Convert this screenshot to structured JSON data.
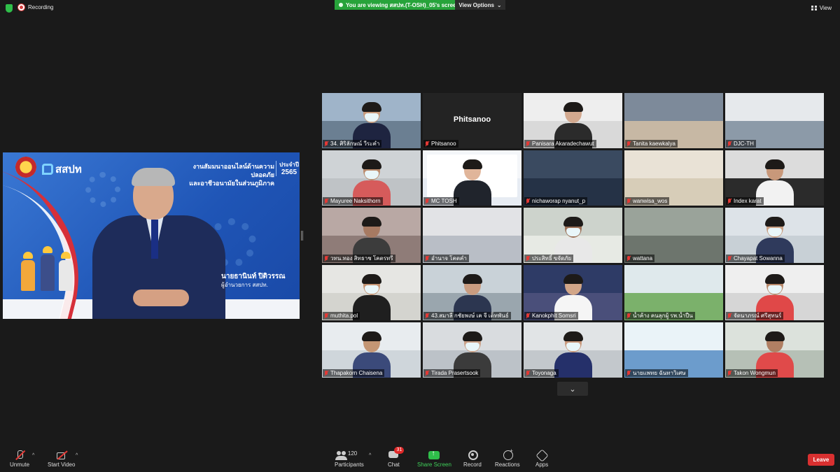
{
  "topbar": {
    "recording_label": "Recording",
    "viewing_text": "You are viewing สสปท.(T-OSH)_05's screen",
    "view_options_label": "View Options",
    "view_label": "View"
  },
  "shared_screen": {
    "brand": "สสปท",
    "headline_line1": "งานสัมมนาออนไลน์ด้านความปลอดภัย",
    "headline_line2": "และอาชีวอนามัยในส่วนภูมิภาค",
    "year_label": "ประจำปี",
    "year": "2565",
    "speaker_name": "นายธานินท์ ปิติวรรณ",
    "speaker_title": "ผู้อำนวยการ สสปท."
  },
  "gallery": {
    "tiles": [
      {
        "name": "34. ศิริลักษณ์ วีระคำ",
        "style": "p1"
      },
      {
        "name": "Phitsanoo",
        "style": "nameonly",
        "center_name": "Phitsanoo"
      },
      {
        "name": "Panisara Akaradechawut",
        "style": "p3"
      },
      {
        "name": "Tanita kaewkalya",
        "style": "p4"
      },
      {
        "name": "DJC-TH",
        "style": "p5"
      },
      {
        "name": "Mayuree Naksithorn",
        "style": "p6"
      },
      {
        "name": "MC TOSH",
        "style": "p7"
      },
      {
        "name": "nichaworap nyanut_p",
        "style": "p8"
      },
      {
        "name": "wanwisa_wos",
        "style": "p9"
      },
      {
        "name": "Index karat",
        "style": "p10"
      },
      {
        "name": "วทน.ทอง สิทธาช โคตรทรี",
        "style": "p11"
      },
      {
        "name": "อำนาจ โคตคำ",
        "style": "p12"
      },
      {
        "name": "ประสิทธิ์ ขจัดภัย",
        "style": "p13"
      },
      {
        "name": "wattana",
        "style": "p14"
      },
      {
        "name": "Chayapat Sowanna",
        "style": "p15"
      },
      {
        "name": "muthita.pol",
        "style": "p16"
      },
      {
        "name": "43.สมาลี กชัยพงษ์ เค จี เด็ทพันธ์",
        "style": "p17"
      },
      {
        "name": "Kanokphit Somsri",
        "style": "p18"
      },
      {
        "name": "น้ำค้าง คนลุกผู้ รพ.น้ำปืน",
        "style": "p19"
      },
      {
        "name": "จัดนาภรณ์ ศรีสุทนร์",
        "style": "p20"
      },
      {
        "name": "Thapakorn Chaisena",
        "style": "p21"
      },
      {
        "name": "Tirada Prasertsook",
        "style": "p22"
      },
      {
        "name": "Toyonaga",
        "style": "p23"
      },
      {
        "name": "นายแพทย ฉันทาวิเศษ",
        "style": "p24"
      },
      {
        "name": "Takon Wongmun",
        "style": "p25"
      }
    ],
    "more_icon": "chevron-down-icon"
  },
  "toolbar": {
    "unmute_label": "Unmute",
    "start_video_label": "Start Video",
    "participants_label": "Participants",
    "participants_count": "120",
    "chat_label": "Chat",
    "chat_badge": "31",
    "share_screen_label": "Share Screen",
    "record_label": "Record",
    "reactions_label": "Reactions",
    "apps_label": "Apps",
    "leave_label": "Leave"
  },
  "colors": {
    "background": "#1a1a1a",
    "share_green": "#27a33a",
    "leave_red": "#d93030",
    "mute_red": "#e53935"
  }
}
